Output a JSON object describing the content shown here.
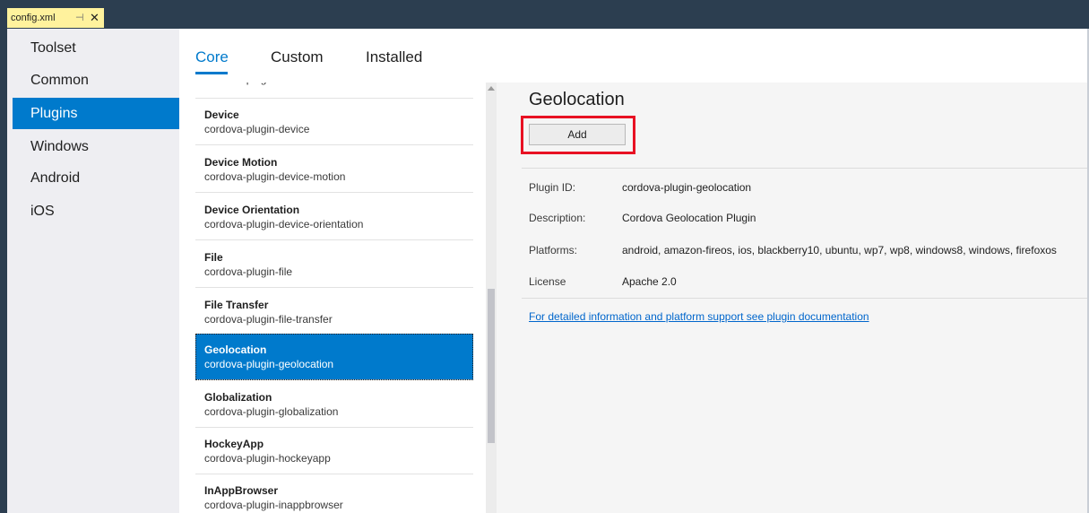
{
  "document_tab": {
    "filename": "config.xml",
    "pin_glyph": "⊣",
    "close_glyph": "✕"
  },
  "nav": {
    "items": [
      {
        "label": "Toolset"
      },
      {
        "label": "Common"
      },
      {
        "label": "Plugins",
        "active": true
      },
      {
        "label": "Windows"
      },
      {
        "label": "Android"
      },
      {
        "label": "iOS"
      }
    ]
  },
  "tabs": [
    {
      "label": "Core",
      "active": true
    },
    {
      "label": "Custom"
    },
    {
      "label": "Installed"
    }
  ],
  "plugins": [
    {
      "name": "",
      "id": "cordova-plugin-crosswalk-webview"
    },
    {
      "name": "Device",
      "id": "cordova-plugin-device"
    },
    {
      "name": "Device Motion",
      "id": "cordova-plugin-device-motion"
    },
    {
      "name": "Device Orientation",
      "id": "cordova-plugin-device-orientation"
    },
    {
      "name": "File",
      "id": "cordova-plugin-file"
    },
    {
      "name": "File Transfer",
      "id": "cordova-plugin-file-transfer"
    },
    {
      "name": "Geolocation",
      "id": "cordova-plugin-geolocation",
      "selected": true
    },
    {
      "name": "Globalization",
      "id": "cordova-plugin-globalization"
    },
    {
      "name": "HockeyApp",
      "id": "cordova-plugin-hockeyapp"
    },
    {
      "name": "InAppBrowser",
      "id": "cordova-plugin-inappbrowser"
    }
  ],
  "details": {
    "title": "Geolocation",
    "add_label": "Add",
    "properties": [
      {
        "key": "Plugin ID:",
        "value": "cordova-plugin-geolocation"
      },
      {
        "key": "Description:",
        "value": "Cordova Geolocation Plugin"
      },
      {
        "key": "Platforms:",
        "value": "android, amazon-fireos, ios, blackberry10, ubuntu, wp7, wp8, windows8, windows, firefoxos"
      },
      {
        "key": "License",
        "value": "Apache 2.0"
      }
    ],
    "doc_link": "For detailed information and platform support see plugin documentation"
  },
  "colors": {
    "accent": "#007acc",
    "highlight_box": "#e81123",
    "tab_strip": "#2c3e50",
    "doc_tab": "#fff29d"
  }
}
